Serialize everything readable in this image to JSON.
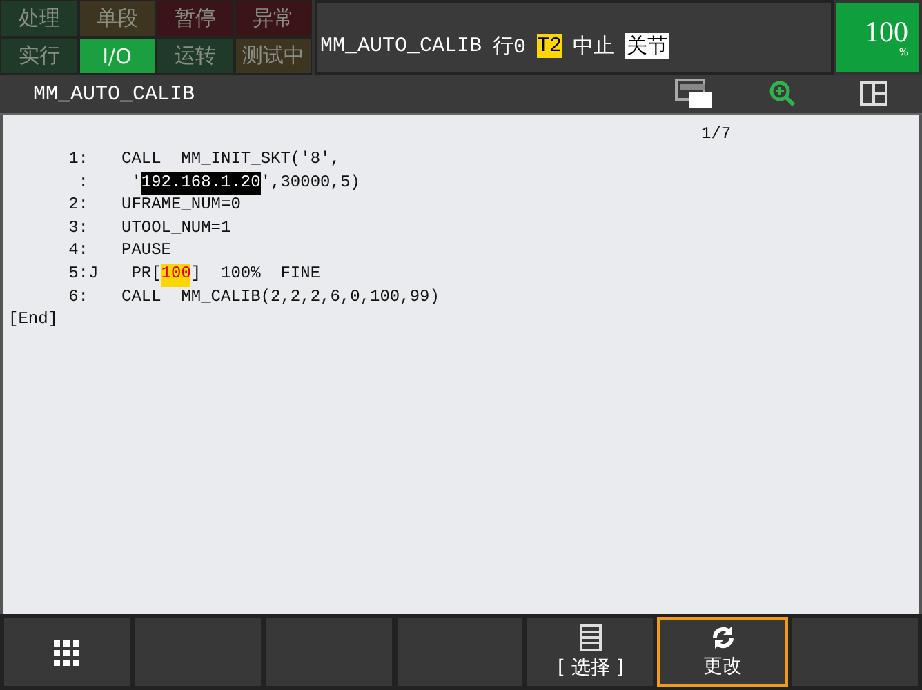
{
  "status_lamps": [
    {
      "label": "处理",
      "on": false,
      "color": "#1f3a26"
    },
    {
      "label": "单段",
      "on": false,
      "color": "#3d3520"
    },
    {
      "label": "暂停",
      "on": false,
      "color": "#3a1416"
    },
    {
      "label": "异常",
      "on": false,
      "color": "#3a1416"
    },
    {
      "label": "实行",
      "on": false,
      "color": "#1f3a26"
    },
    {
      "label": "I/O",
      "on": true,
      "color": "#1aa041"
    },
    {
      "label": "运转",
      "on": false,
      "color": "#1f3a26"
    },
    {
      "label": "测试中",
      "on": false,
      "color": "#3d3520"
    }
  ],
  "info": [
    {
      "text": "MM_AUTO_CALIB",
      "kind": "plain"
    },
    {
      "text": "行0",
      "kind": "plain"
    },
    {
      "text": "T2",
      "kind": "warning"
    },
    {
      "text": "中止",
      "kind": "plain"
    },
    {
      "text": "关节",
      "kind": "inverse"
    }
  ],
  "speed": {
    "value": "100",
    "unit": "%"
  },
  "title": "MM_AUTO_CALIB",
  "page": "1/7",
  "lines": [
    {
      "kind": "line",
      "number": "1:",
      "parts": [
        {
          "text": "CALL  MM_INIT_SKT('8',",
          "kind": "plain"
        }
      ]
    },
    {
      "kind": "line",
      "number": ":",
      "parts": [
        {
          "text": " '",
          "kind": "plain"
        },
        {
          "text": "192.168.1.20",
          "kind": "cursor"
        },
        {
          "text": "',30000,5)",
          "kind": "plain"
        }
      ]
    },
    {
      "kind": "line",
      "number": "2:",
      "parts": [
        {
          "text": "UFRAME_NUM=0",
          "kind": "plain"
        }
      ]
    },
    {
      "kind": "line",
      "number": "3:",
      "parts": [
        {
          "text": "UTOOL_NUM=1",
          "kind": "plain"
        }
      ]
    },
    {
      "kind": "line",
      "number": "4:",
      "parts": [
        {
          "text": "PAUSE",
          "kind": "plain"
        }
      ]
    },
    {
      "kind": "line",
      "number": "5:",
      "motion": "J",
      "parts": [
        {
          "text": " PR[",
          "kind": "plain"
        },
        {
          "text": "100",
          "kind": "register"
        },
        {
          "text": "]  100%  FINE",
          "kind": "plain"
        }
      ]
    },
    {
      "kind": "line",
      "number": "6:",
      "parts": [
        {
          "text": "CALL  MM_CALIB(2,2,2,6,0,100,99)",
          "kind": "plain"
        }
      ]
    },
    {
      "kind": "end",
      "text": "[End]"
    }
  ],
  "function_keys": [
    {
      "kind": "grid",
      "selected": false
    },
    {
      "kind": "blank",
      "selected": false
    },
    {
      "kind": "blank",
      "selected": false
    },
    {
      "kind": "blank",
      "selected": false
    },
    {
      "kind": "select",
      "label": "[ 选择 ]",
      "selected": false
    },
    {
      "kind": "change",
      "label": "更改",
      "selected": true
    },
    {
      "kind": "blank",
      "selected": false
    }
  ]
}
